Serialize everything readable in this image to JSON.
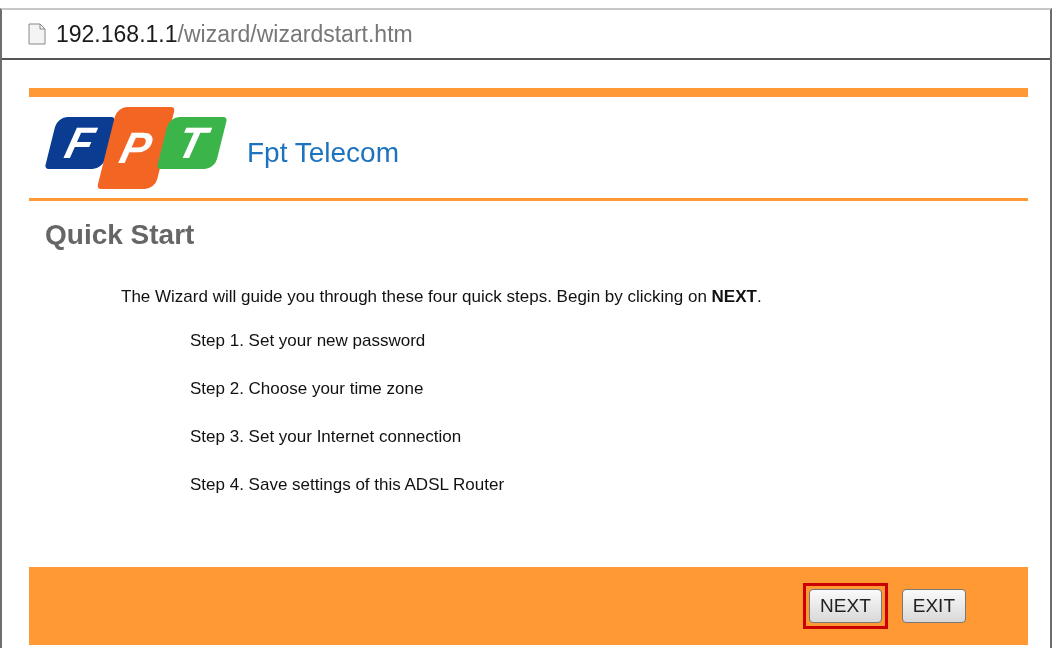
{
  "address_bar": {
    "host": "192.168.1.1",
    "path": "/wizard/wizardstart.htm"
  },
  "logo": {
    "letters": [
      "F",
      "P",
      "T"
    ],
    "brand": "Fpt Telecom"
  },
  "heading": "Quick Start",
  "intro": "The Wizard will guide you through these four quick steps. Begin by clicking on **NEXT**.",
  "steps": [
    "Step 1. Set your new password",
    "Step 2. Choose your time zone",
    "Step 3. Set your Internet connection",
    "Step 4. Save settings of this ADSL Router"
  ],
  "buttons": [
    {
      "label": "NEXT",
      "highlighted": true
    },
    {
      "label": "EXIT",
      "highlighted": false
    }
  ]
}
